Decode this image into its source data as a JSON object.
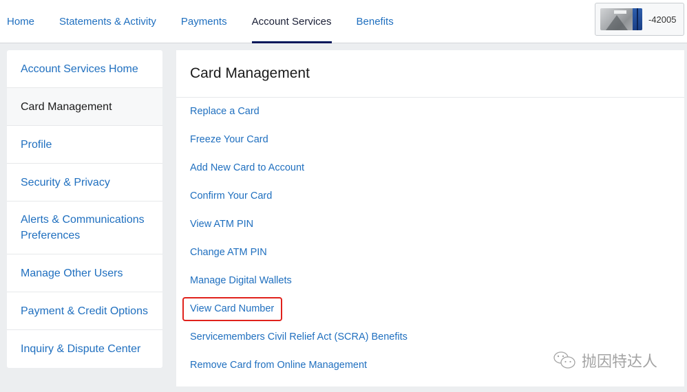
{
  "nav": {
    "items": [
      {
        "label": "Home",
        "active": false
      },
      {
        "label": "Statements & Activity",
        "active": false
      },
      {
        "label": "Payments",
        "active": false
      },
      {
        "label": "Account Services",
        "active": true
      },
      {
        "label": "Benefits",
        "active": false
      }
    ]
  },
  "card_switcher": {
    "card_image": "card-thumbnail-icon",
    "card_suffix": "-42005"
  },
  "sidebar": {
    "items": [
      {
        "label": "Account Services Home"
      },
      {
        "label": "Card Management",
        "active": true
      },
      {
        "label": "Profile"
      },
      {
        "label": "Security & Privacy"
      },
      {
        "label": "Alerts & Communications Preferences"
      },
      {
        "label": "Manage Other Users"
      },
      {
        "label": "Payment & Credit Options"
      },
      {
        "label": "Inquiry & Dispute Center"
      }
    ]
  },
  "main": {
    "title": "Card Management",
    "links": [
      {
        "label": "Replace a Card"
      },
      {
        "label": "Freeze Your Card"
      },
      {
        "label": "Add New Card to Account"
      },
      {
        "label": "Confirm Your Card"
      },
      {
        "label": "View ATM PIN"
      },
      {
        "label": "Change ATM PIN"
      },
      {
        "label": "Manage Digital Wallets"
      },
      {
        "label": "View Card Number",
        "highlighted": true
      },
      {
        "label": "Servicemembers Civil Relief Act (SCRA) Benefits"
      },
      {
        "label": "Remove Card from Online Management"
      }
    ],
    "highlight_color": "#e0211b"
  },
  "watermark": {
    "icon": "wechat-icon",
    "text": "抛因特达人"
  },
  "colors": {
    "link": "#1f6fbf",
    "active_underline": "#00175a",
    "background": "#eceef0"
  }
}
